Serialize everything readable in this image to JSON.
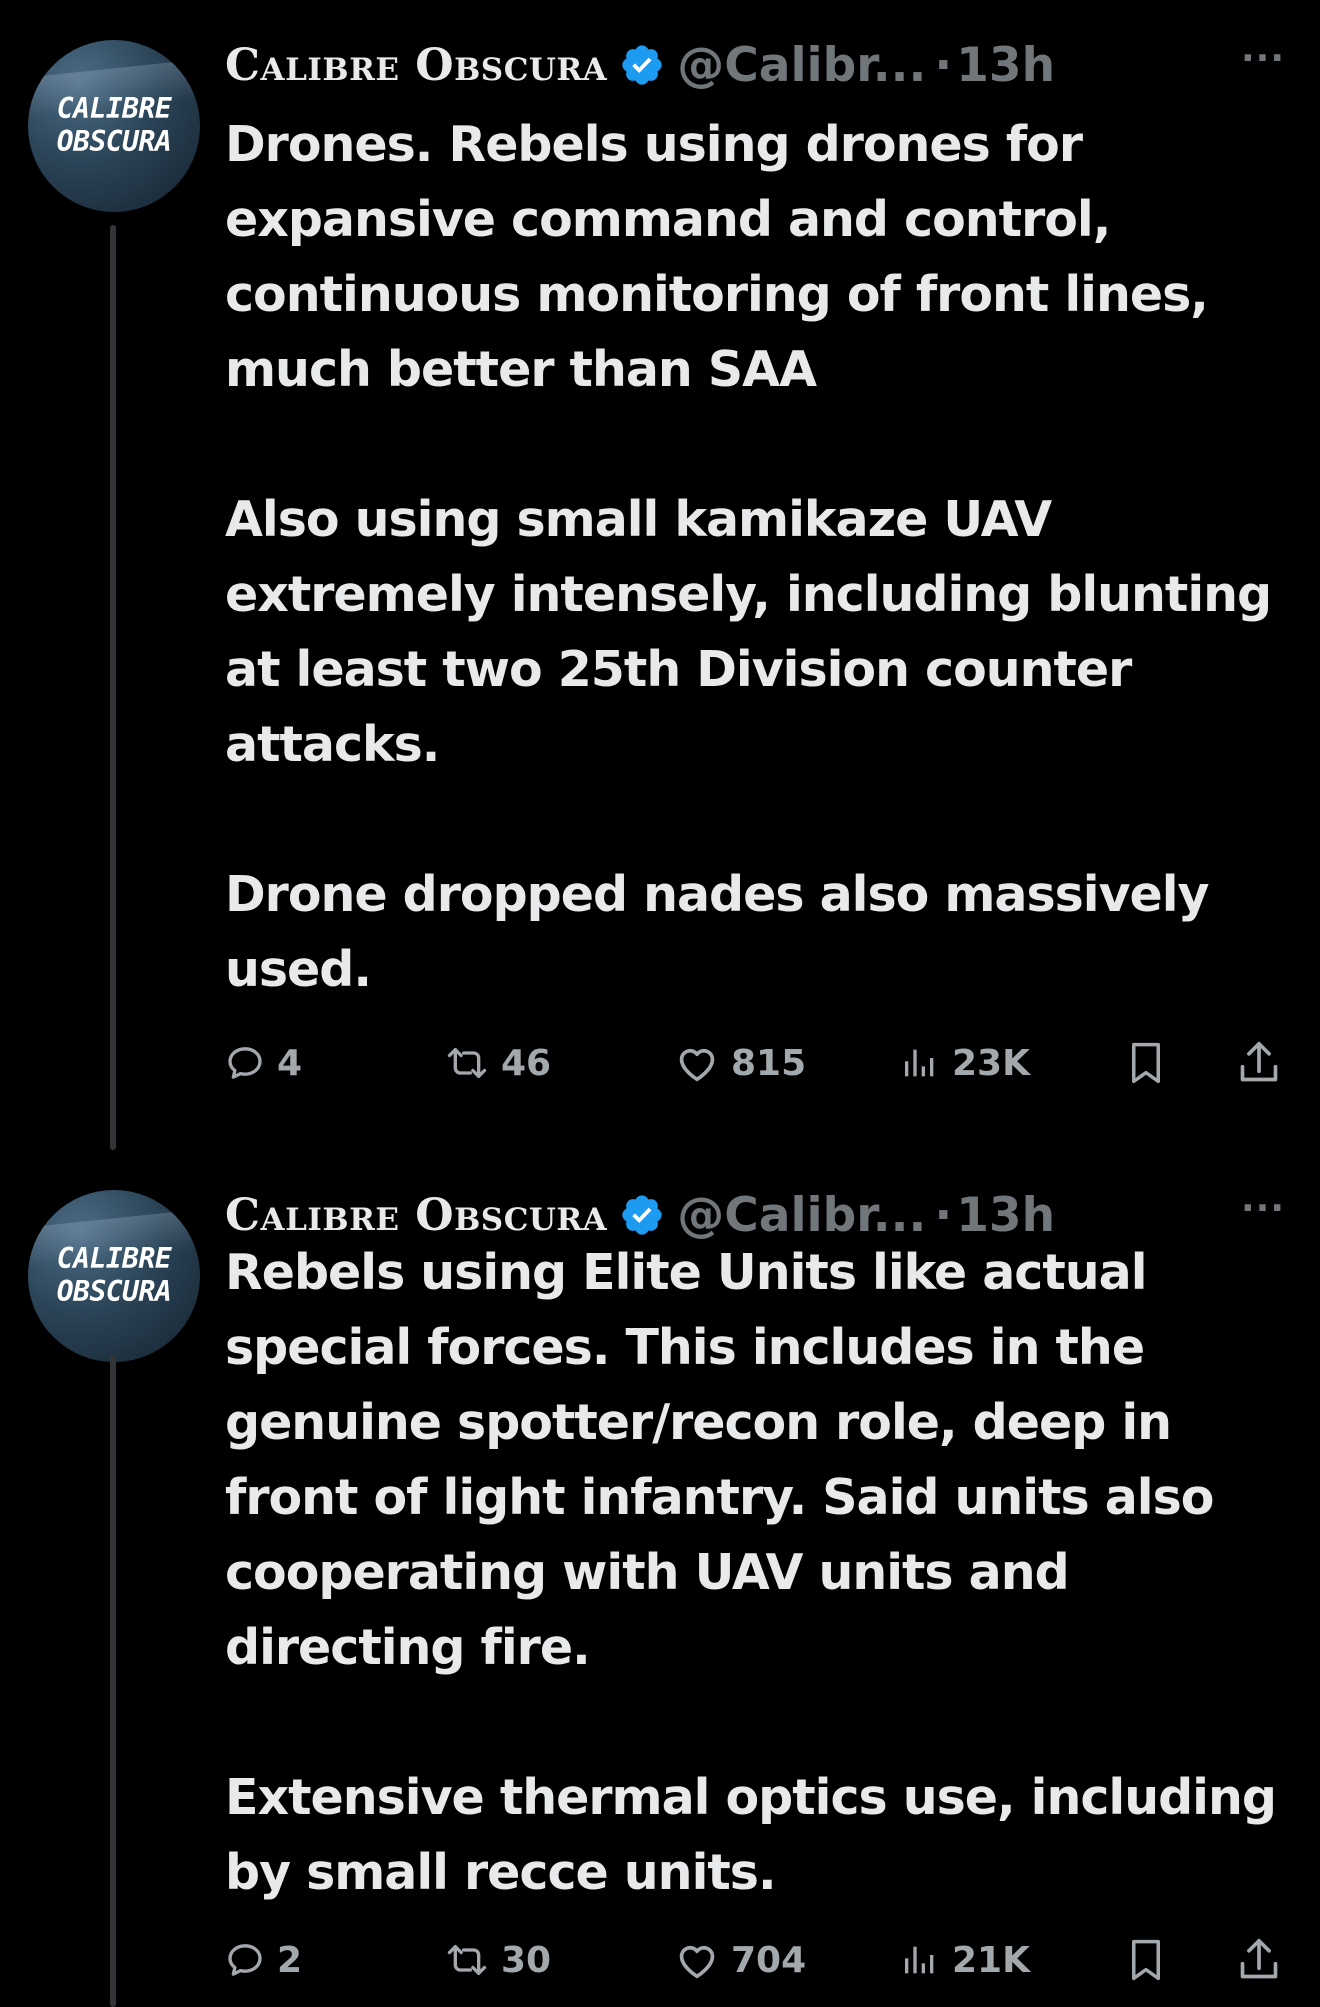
{
  "colors": {
    "background": "#000000",
    "text": "#e7e9ea",
    "muted": "#71767b",
    "verified": "#1d9bf0",
    "thread_line": "#333639"
  },
  "tweets": [
    {
      "author": {
        "display_name": "Calibre Obscura",
        "handle": "@Calibr...",
        "avatar_text": [
          "CALIBRE",
          "OBSCURA"
        ],
        "verified_icon": "verified-badge-icon"
      },
      "separator": "·",
      "time": "13h",
      "more_icon": "···",
      "paragraphs": [
        "Drones. Rebels using drones for expansive command and control, continuous monitoring of front lines, much better than SAA",
        "Also using small kamikaze UAV extremely intensely, including blunting at least two 25th Division counter attacks.",
        "Drone dropped nades also massively used."
      ],
      "stats": {
        "replies": "4",
        "reposts": "46",
        "likes": "815",
        "views": "23K"
      }
    },
    {
      "author": {
        "display_name": "Calibre Obscura",
        "handle": "@Calibr...",
        "avatar_text": [
          "CALIBRE",
          "OBSCURA"
        ],
        "verified_icon": "verified-badge-icon"
      },
      "separator": "·",
      "time": "13h",
      "more_icon": "···",
      "paragraphs": [
        "Rebels using Elite Units like actual special forces. This includes in the genuine spotter/recon role, deep in front of light infantry. Said units also cooperating with UAV units and directing fire.",
        "Extensive thermal optics use, including by small recce units."
      ],
      "stats": {
        "replies": "2",
        "reposts": "30",
        "likes": "704",
        "views": "21K"
      }
    }
  ]
}
